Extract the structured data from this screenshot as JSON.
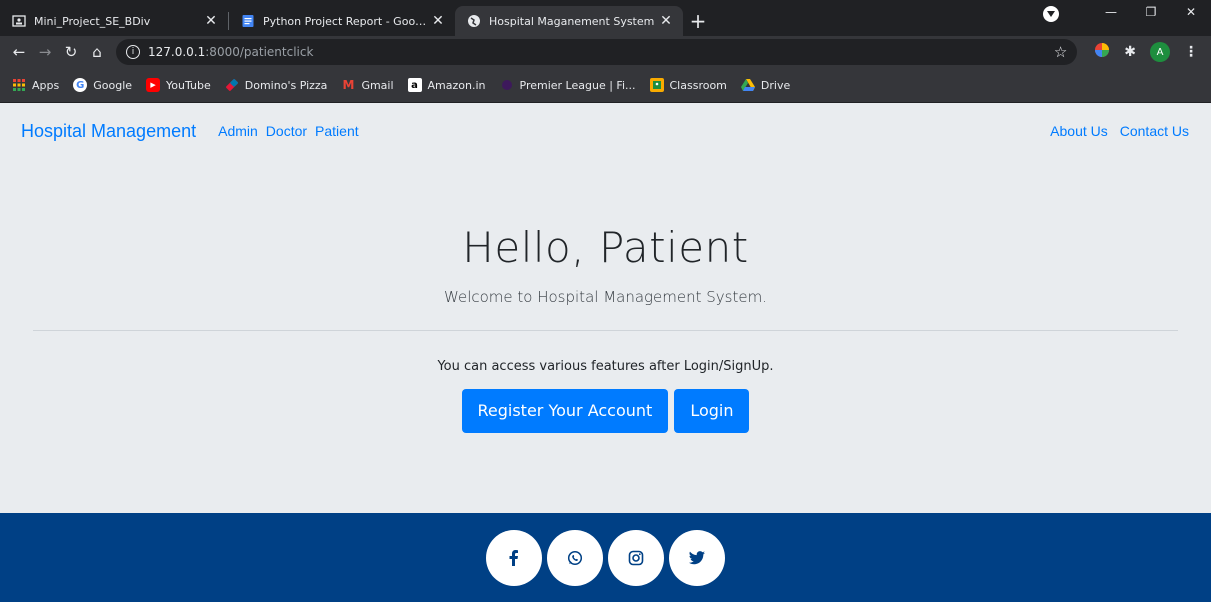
{
  "browser": {
    "tabs": [
      {
        "title": "Mini_Project_SE_BDiv",
        "active": false
      },
      {
        "title": "Python Project Report - Google D",
        "active": false
      },
      {
        "title": "Hospital Maganement System",
        "active": true
      }
    ],
    "url_host": "127.0.0.1",
    "url_path": ":8000/patientclick",
    "profile_initial": "A",
    "bookmarks": [
      "Apps",
      "Google",
      "YouTube",
      "Domino's Pizza",
      "Gmail",
      "Amazon.in",
      "Premier League | Fi...",
      "Classroom",
      "Drive"
    ]
  },
  "navbar": {
    "brand": "Hospital Management",
    "links": [
      "Admin",
      "Doctor",
      "Patient"
    ],
    "right_links": [
      "About Us",
      "Contact Us"
    ]
  },
  "hero": {
    "title": "Hello, Patient",
    "lead": "Welcome to Hospital Management System.",
    "info": "You can access various features after Login/SignUp.",
    "register_label": "Register Your Account",
    "login_label": "Login"
  },
  "footer": {
    "social": [
      "facebook-icon",
      "whatsapp-icon",
      "instagram-icon",
      "twitter-icon"
    ],
    "bg_color": "#004085"
  },
  "colors": {
    "primary": "#007bff",
    "page_bg": "#e9ecef"
  }
}
